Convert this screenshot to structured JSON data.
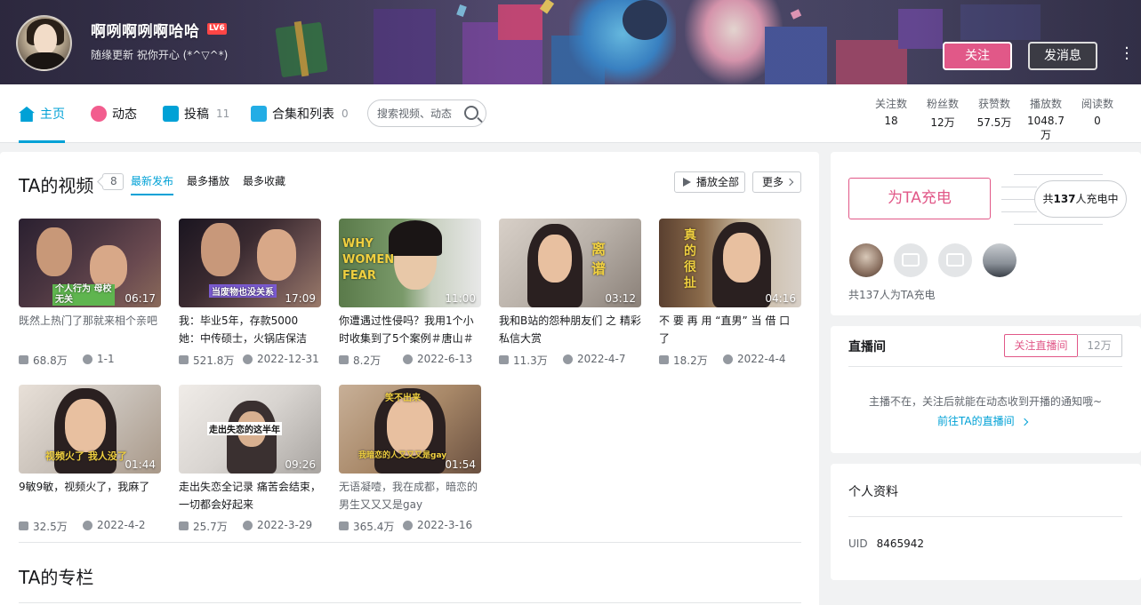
{
  "header": {
    "username": "啊咧啊咧啊哈哈",
    "level": "LV6",
    "signature": "随缘更新 祝你开心 (*^▽^*)",
    "follow_label": "关注",
    "message_label": "发消息"
  },
  "nav": {
    "tabs": [
      {
        "label": "主页",
        "count": ""
      },
      {
        "label": "动态",
        "count": ""
      },
      {
        "label": "投稿",
        "count": "11"
      },
      {
        "label": "合集和列表",
        "count": "0"
      }
    ],
    "search_placeholder": "搜索视频、动态",
    "stats": [
      {
        "label": "关注数",
        "value": "18"
      },
      {
        "label": "粉丝数",
        "value": "12万"
      },
      {
        "label": "获赞数",
        "value": "57.5万"
      },
      {
        "label": "播放数",
        "value": "1048.7万"
      },
      {
        "label": "阅读数",
        "value": "0"
      }
    ]
  },
  "videos": {
    "title": "TA的视频",
    "count": "8",
    "sorts": [
      "最新发布",
      "最多播放",
      "最多收藏"
    ],
    "play_all": "播放全部",
    "more": "更多",
    "items": [
      {
        "title": "既然上热门了那就来相个亲吧",
        "duration": "06:17",
        "views": "68.8万",
        "date": "1-1",
        "caption": "个人行为 母校无关"
      },
      {
        "title": "我：毕业5年，存款5000 她：中传硕士，火锅店保洁",
        "duration": "17:09",
        "views": "521.8万",
        "date": "2022-12-31",
        "caption": "当废物也没关系"
      },
      {
        "title": "你遭遇过性侵吗？我用1个小时收集到了5个案例＃唐山＃",
        "duration": "11:00",
        "views": "8.2万",
        "date": "2022-6-13",
        "caption": "WHY WOMEN FEAR"
      },
      {
        "title": "我和B站的怨种朋友们 之 精彩私信大赏",
        "duration": "03:12",
        "views": "11.3万",
        "date": "2022-4-7",
        "caption": "离谱"
      },
      {
        "title": "不 要 再 用 “直男” 当 借 口 了",
        "duration": "04:16",
        "views": "18.2万",
        "date": "2022-4-4",
        "caption": "真的很扯"
      },
      {
        "title": "9敏9敏，视频火了，我麻了",
        "duration": "01:44",
        "views": "32.5万",
        "date": "2022-4-2",
        "caption": "视频火了 我人没了"
      },
      {
        "title": "走出失恋全记录 痛苦会结束，一切都会好起来",
        "duration": "09:26",
        "views": "25.7万",
        "date": "2022-3-29",
        "caption": "走出失恋的这半年"
      },
      {
        "title": "无语凝噎，我在成都，暗恋的男生又又又是gay",
        "duration": "01:54",
        "views": "365.4万",
        "date": "2022-3-16",
        "caption": "我暗恋的人又又又是gay"
      }
    ],
    "extra_caption_8": "笑不出来"
  },
  "column": {
    "title": "TA的专栏"
  },
  "charge": {
    "button_label": "为TA充电",
    "count_prefix": "共",
    "count_value": "137",
    "count_suffix": "人充电中",
    "note": "共137人为TA充电"
  },
  "live": {
    "title": "直播间",
    "follow_label": "关注直播间",
    "follow_count": "12万",
    "message": "主播不在，关注后就能在动态收到开播的通知哦~",
    "link_label": "前往TA的直播间"
  },
  "profile": {
    "title": "个人资料",
    "uid_label": "UID",
    "uid_value": "8465942"
  },
  "colors": {
    "accent": "#00a1d6",
    "pink": "#e15888"
  }
}
